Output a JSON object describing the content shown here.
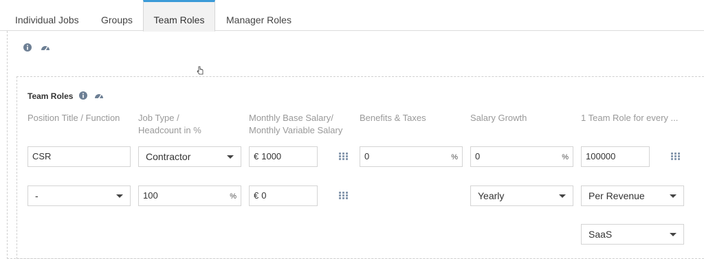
{
  "tabs": [
    {
      "label": "Individual Jobs"
    },
    {
      "label": "Groups"
    },
    {
      "label": "Team Roles"
    },
    {
      "label": "Manager Roles"
    }
  ],
  "active_tab": "Team Roles",
  "accent_color": "#3b9bd8",
  "section": {
    "title": "Team Roles"
  },
  "columns": {
    "position": "Position Title / Function",
    "job_type_line1": "Job Type /",
    "job_type_line2": "Headcount in %",
    "salary_line1": "Monthly Base Salary/",
    "salary_line2": "Monthly Variable Salary",
    "benefits": "Benefits & Taxes",
    "growth": "Salary Growth",
    "ratio": "1 Team Role for every ..."
  },
  "row1": {
    "position_value": "CSR",
    "job_type_selected": "Contractor",
    "base_salary_prefix": "€",
    "base_salary_value": "1000",
    "benefits_value": "0",
    "benefits_unit": "%",
    "growth_value": "0",
    "growth_unit": "%",
    "ratio_value": "100000"
  },
  "row2": {
    "position_selected": "-",
    "headcount_value": "100",
    "headcount_unit": "%",
    "variable_salary_prefix": "€",
    "variable_salary_value": "0",
    "growth_period_selected": "Yearly",
    "ratio_basis_selected": "Per Revenue"
  },
  "row3": {
    "revenue_type_selected": "SaaS"
  },
  "icons": [
    "info-icon",
    "dashboard-icon",
    "grid-icon",
    "caret-down-icon",
    "pointer-cursor-icon"
  ]
}
